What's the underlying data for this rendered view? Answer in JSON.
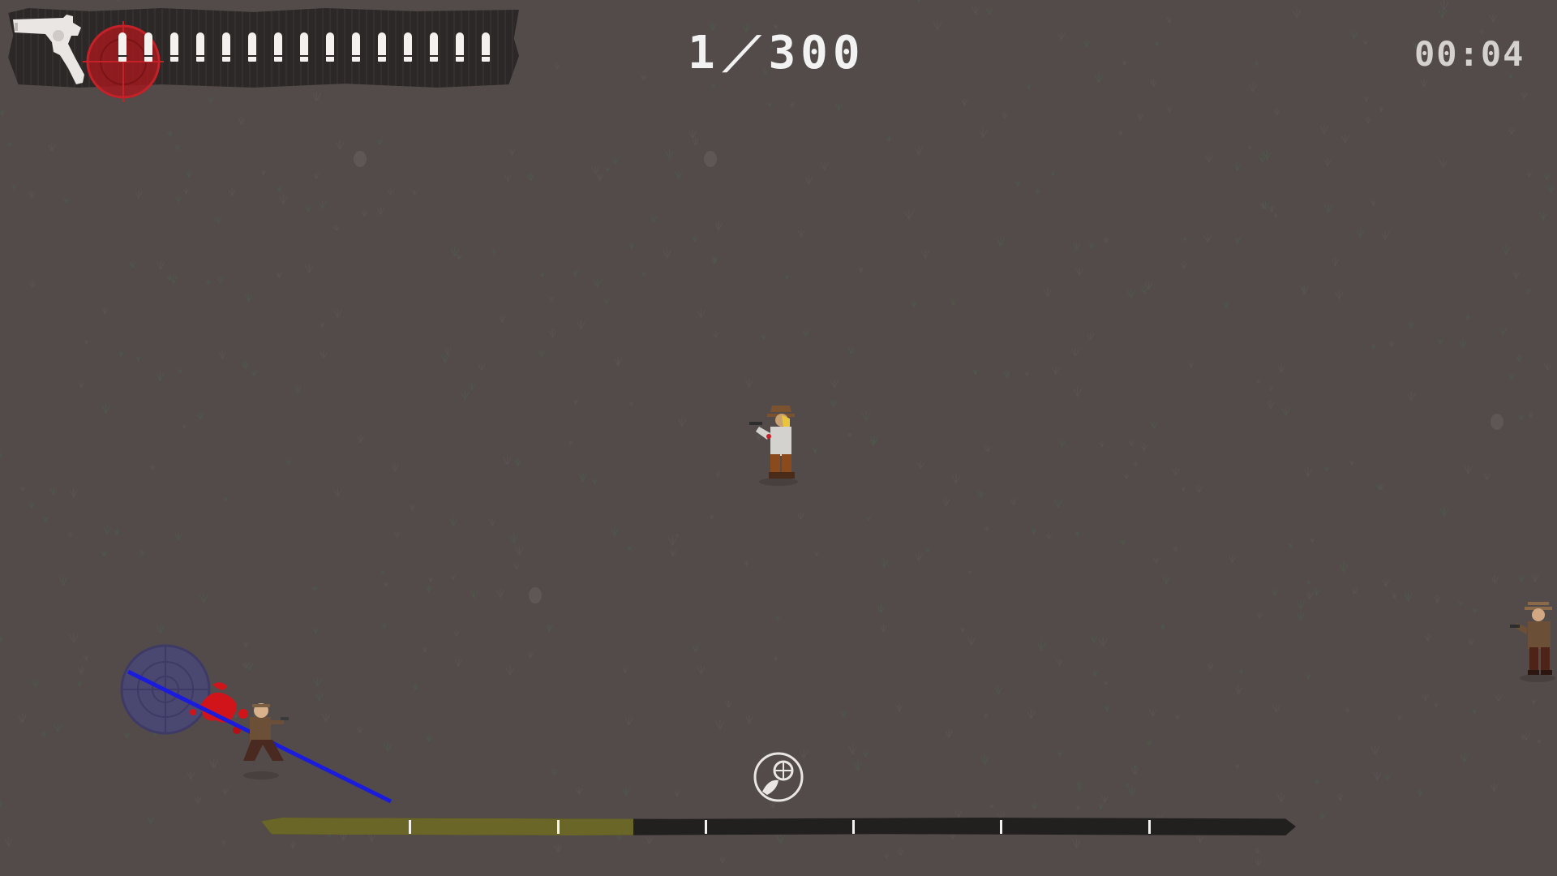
{
  "hud": {
    "weapon_icon": "revolver-icon",
    "reticle_icon": "red-crosshair-icon",
    "ammo": {
      "loaded": 15,
      "capacity": 15
    },
    "score": {
      "current": "1",
      "separator": "/",
      "target": "300"
    },
    "timer": "00:04"
  },
  "progress": {
    "fill_fraction": 0.36,
    "segments": 7,
    "fill_color": "#6a6628",
    "track_color": "#221f1f"
  },
  "center_icon": "skull-bullet-icon",
  "colors": {
    "ground": "#534b4a",
    "aim_line": "#1b1bdc",
    "blood": "#d0141a",
    "hud_text": "#f2f2f2"
  },
  "entities": [
    {
      "type": "player-gunslinger",
      "name": "player"
    },
    {
      "type": "enemy-bandit",
      "name": "enemy-shot",
      "state": "hit"
    },
    {
      "type": "enemy-bandit",
      "name": "enemy-right",
      "state": "aiming"
    }
  ]
}
